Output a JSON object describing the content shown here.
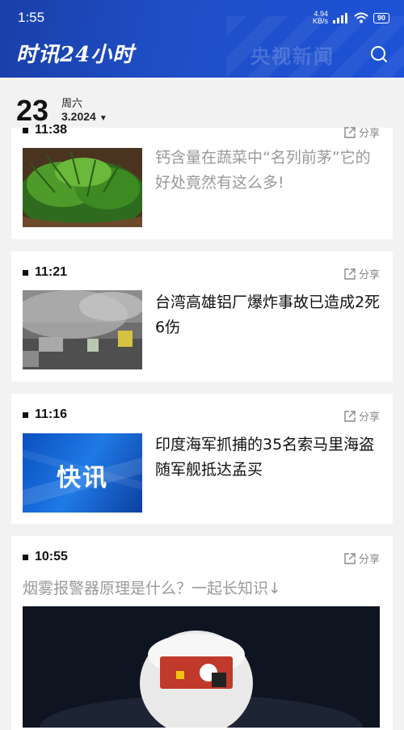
{
  "status_bar": {
    "time": "1:55",
    "net_speed_value": "4.94",
    "net_speed_unit": "KB/s",
    "battery": "90"
  },
  "header": {
    "brand": "时讯24小时",
    "watermark": "央视新闻",
    "search_icon": "search-icon"
  },
  "date": {
    "day": "23",
    "weekday": "周六",
    "month_year": "3.2024",
    "caret": "▼"
  },
  "news": [
    {
      "time": "11:38",
      "share_label": "分享",
      "headline": "钙含量在蔬菜中“名列前茅”它的好处竟然有这么多!",
      "read": true,
      "thumb": "green-vegetables"
    },
    {
      "time": "11:21",
      "share_label": "分享",
      "headline": "台湾高雄铝厂爆炸事故已造成2死6伤",
      "read": false,
      "thumb": "factory-smoke"
    },
    {
      "time": "11:16",
      "share_label": "分享",
      "headline": "印度海军抓捕的35名索马里海盗随军舰抵达孟买",
      "read": false,
      "thumb": "flash-news",
      "thumb_text": "快讯"
    },
    {
      "time": "10:55",
      "share_label": "分享",
      "headline": "烟雾报警器原理是什么？一起长知识↓",
      "read": true,
      "thumb": "smoke-detector"
    }
  ],
  "colors": {
    "header_blue": "#1f4fc8",
    "read_text": "#999999",
    "background": "#f2f2f2"
  }
}
